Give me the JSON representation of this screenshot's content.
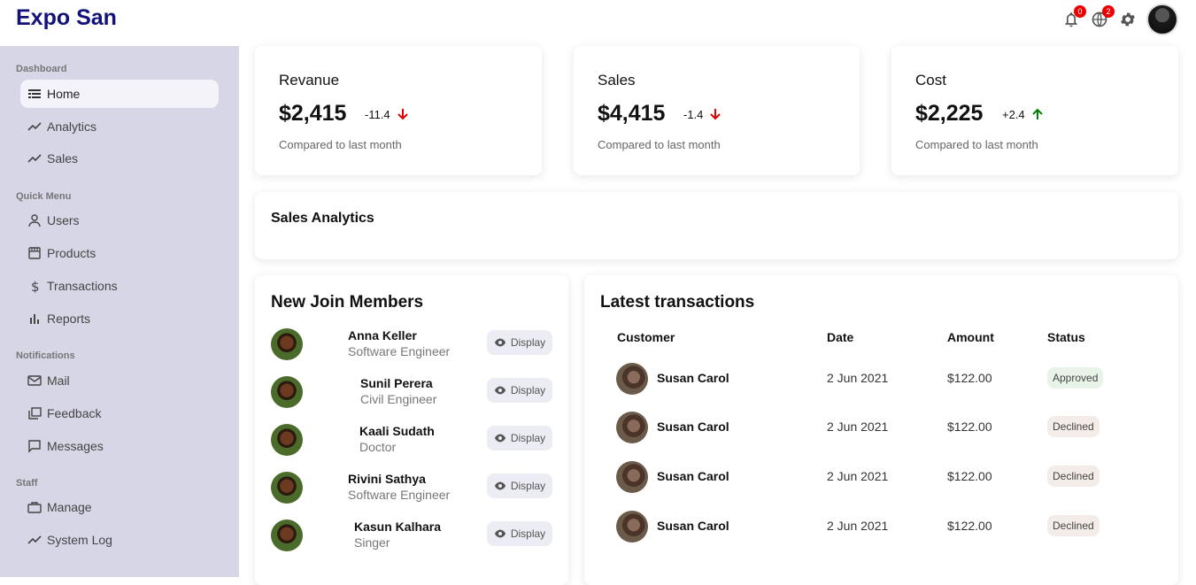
{
  "app": {
    "title": "Expo San"
  },
  "topbar": {
    "notifications_count": "0",
    "language_count": "2",
    "icons": [
      "bell-icon",
      "globe-icon",
      "gear-icon"
    ]
  },
  "sidebar": {
    "sections": [
      {
        "title": "Dashboard",
        "items": [
          {
            "label": "Home",
            "icon": "home-icon",
            "active": true
          },
          {
            "label": "Analytics",
            "icon": "trending-icon"
          },
          {
            "label": "Sales",
            "icon": "trending-icon"
          }
        ]
      },
      {
        "title": "Quick Menu",
        "items": [
          {
            "label": "Users",
            "icon": "user-icon"
          },
          {
            "label": "Products",
            "icon": "store-icon"
          },
          {
            "label": "Transactions",
            "icon": "dollar-icon"
          },
          {
            "label": "Reports",
            "icon": "bar-chart-icon"
          }
        ]
      },
      {
        "title": "Notifications",
        "items": [
          {
            "label": "Mail",
            "icon": "mail-icon"
          },
          {
            "label": "Feedback",
            "icon": "feedback-icon"
          },
          {
            "label": "Messages",
            "icon": "chat-icon"
          }
        ]
      },
      {
        "title": "Staff",
        "items": [
          {
            "label": "Manage",
            "icon": "briefcase-icon"
          },
          {
            "label": "System Log",
            "icon": "trending-icon"
          }
        ]
      }
    ]
  },
  "featured": [
    {
      "title": "Revanue",
      "value": "$2,415",
      "rate": "-11.4",
      "direction": "down",
      "sub": "Compared to last month"
    },
    {
      "title": "Sales",
      "value": "$4,415",
      "rate": "-1.4",
      "direction": "down",
      "sub": "Compared to last month"
    },
    {
      "title": "Cost",
      "value": "$2,225",
      "rate": "+2.4",
      "direction": "up",
      "sub": "Compared to last month"
    }
  ],
  "sales_analytics": {
    "title": "Sales Analytics"
  },
  "members": {
    "title": "New Join Members",
    "button_label": "Display",
    "items": [
      {
        "name": "Anna Keller",
        "job": "Software Engineer"
      },
      {
        "name": "Sunil Perera",
        "job": "Civil Engineer"
      },
      {
        "name": "Kaali Sudath",
        "job": "Doctor"
      },
      {
        "name": "Rivini Sathya",
        "job": "Software Engineer"
      },
      {
        "name": "Kasun Kalhara",
        "job": "Singer"
      }
    ]
  },
  "transactions": {
    "title": "Latest transactions",
    "headers": [
      "Customer",
      "Date",
      "Amount",
      "Status"
    ],
    "rows": [
      {
        "customer": "Susan Carol",
        "date": "2 Jun 2021",
        "amount": "$122.00",
        "status": "Approved"
      },
      {
        "customer": "Susan Carol",
        "date": "2 Jun 2021",
        "amount": "$122.00",
        "status": "Declined"
      },
      {
        "customer": "Susan Carol",
        "date": "2 Jun 2021",
        "amount": "$122.00",
        "status": "Declined"
      },
      {
        "customer": "Susan Carol",
        "date": "2 Jun 2021",
        "amount": "$122.00",
        "status": "Declined"
      }
    ]
  },
  "colors": {
    "brand": "#12127a",
    "sidebar": "#d7d6e6",
    "down": "#e00000",
    "up": "#008000"
  }
}
